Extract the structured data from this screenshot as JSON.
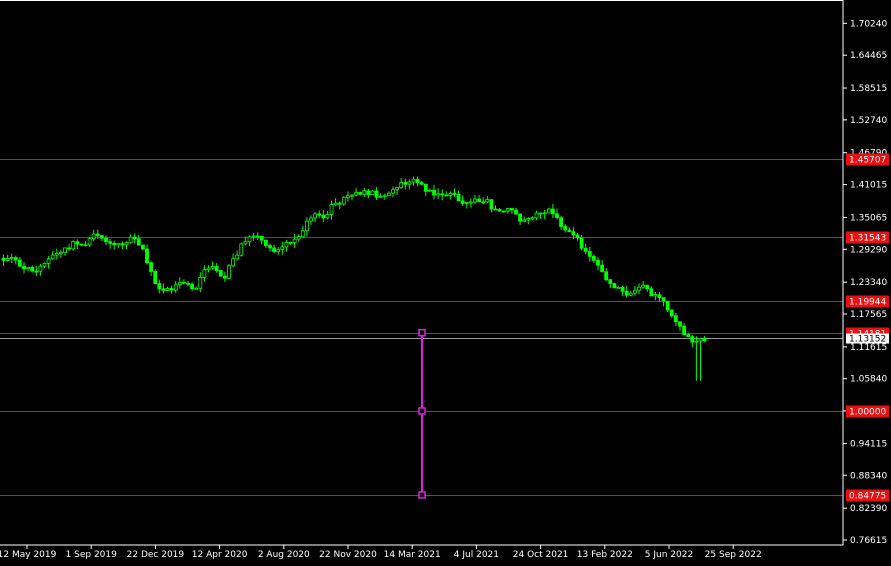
{
  "chart_data": {
    "type": "candlestick",
    "price_axis": {
      "ylim": [
        0.76615,
        1.73015
      ],
      "ticks": [
        "1.70240",
        "1.64465",
        "1.58515",
        "1.52740",
        "1.46790",
        "1.41015",
        "1.35065",
        "1.29290",
        "1.23340",
        "1.17565",
        "1.11615",
        "1.05840",
        "1.00000",
        "0.94115",
        "0.88340",
        "0.82390",
        "0.76615"
      ]
    },
    "time_axis": {
      "labels": [
        "12 May 2019",
        "1 Sep 2019",
        "22 Dec 2019",
        "12 Apr 2020",
        "2 Aug 2020",
        "22 Nov 2020",
        "14 Mar 2021",
        "4 Jul 2021",
        "24 Oct 2021",
        "13 Feb 2022",
        "5 Jun 2022",
        "25 Sep 2022"
      ]
    },
    "horizontal_levels": [
      {
        "value": 1.457,
        "label": "1.45707",
        "color": "#e81010"
      },
      {
        "value": 1.3154,
        "label": "1.31543",
        "color": "#e81010"
      },
      {
        "value": 1.1994,
        "label": "1.19944",
        "color": "#e81010"
      },
      {
        "value": 1.1418,
        "label": "1.14181",
        "color": "#e81010"
      },
      {
        "value": 1.0,
        "label": "1.00000",
        "color": "#e81010"
      },
      {
        "value": 0.8478,
        "label": "0.84775",
        "color": "#e81010"
      }
    ],
    "current_price": {
      "value": 1.1315,
      "label": "1.13152"
    },
    "measure_line": {
      "top": 1.1418,
      "mid": 1.0,
      "bottom": 0.8478,
      "color": "#e020e0"
    },
    "bull_color": "#00ff00",
    "bear_color": "#ffffff",
    "close_path": [
      1.275,
      1.273,
      1.262,
      1.249,
      1.27,
      1.284,
      1.291,
      1.305,
      1.301,
      1.324,
      1.308,
      1.305,
      1.298,
      1.314,
      1.286,
      1.235,
      1.214,
      1.224,
      1.236,
      1.216,
      1.255,
      1.268,
      1.241,
      1.279,
      1.303,
      1.32,
      1.31,
      1.287,
      1.302,
      1.311,
      1.333,
      1.352,
      1.355,
      1.375,
      1.383,
      1.39,
      1.401,
      1.392,
      1.385,
      1.402,
      1.414,
      1.418,
      1.405,
      1.396,
      1.387,
      1.393,
      1.378,
      1.38,
      1.385,
      1.364,
      1.366,
      1.357,
      1.342,
      1.359,
      1.364,
      1.36,
      1.329,
      1.317,
      1.292,
      1.272,
      1.239,
      1.226,
      1.211,
      1.22,
      1.223,
      1.206,
      1.197,
      1.165,
      1.143,
      1.125,
      1.128
    ]
  }
}
